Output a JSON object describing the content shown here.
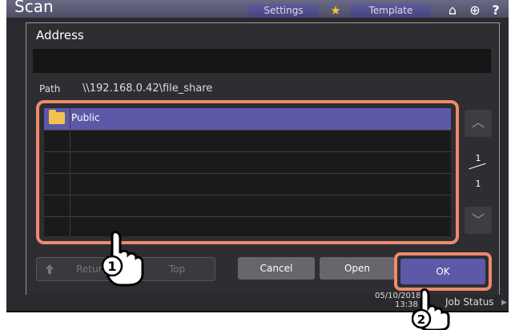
{
  "app": {
    "title": "Scan"
  },
  "topbar": {
    "settings_label": "Settings",
    "template_label": "Template",
    "star_glyph": "★",
    "home_icon": "⌂",
    "globe_icon": "⊕",
    "help_icon": "?"
  },
  "dialog": {
    "title": "Address",
    "address_value": "",
    "path_label": "Path",
    "path_value": "\\\\192.168.0.42\\file_share",
    "list": {
      "items": [
        {
          "label": "Public",
          "icon": "folder-icon",
          "selected": true
        },
        {
          "label": ""
        },
        {
          "label": ""
        },
        {
          "label": ""
        },
        {
          "label": ""
        },
        {
          "label": ""
        }
      ]
    },
    "pagination": {
      "current": "1",
      "total": "1"
    },
    "scroll_up_glyph": "︿",
    "scroll_down_glyph": "﹀",
    "buttons": {
      "return_label": "Return",
      "top_label": "Top",
      "cancel_label": "Cancel",
      "open_label": "Open",
      "ok_label": "OK"
    }
  },
  "statusbar": {
    "date": "05/10/2018",
    "time": "13:38",
    "job_status_label": "Job Status"
  },
  "callouts": {
    "step1": "1",
    "step2": "2"
  },
  "colors": {
    "selection": "#5c59a8",
    "highlight": "#ee8a6c",
    "folder": "#f3c34d"
  }
}
